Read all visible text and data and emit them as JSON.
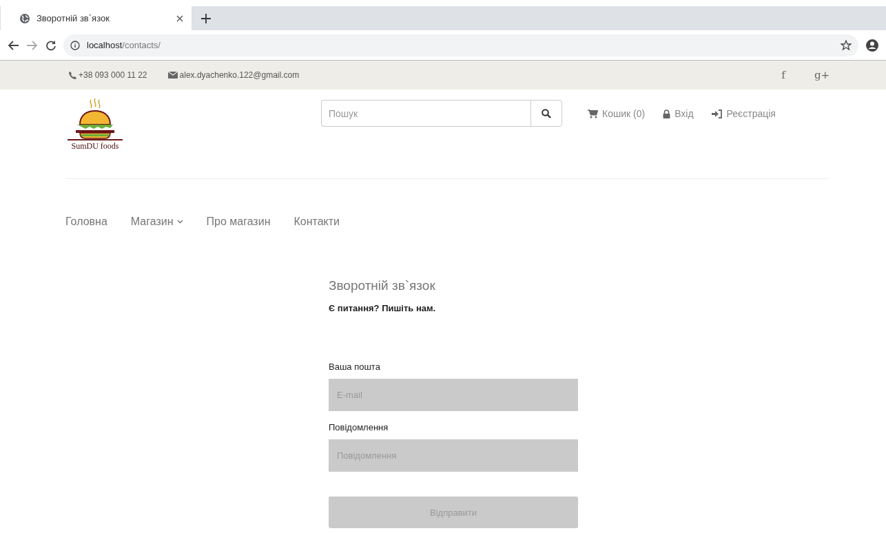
{
  "browser": {
    "tab_title": "Зворотній зв`язок",
    "url_host": "localhost",
    "url_path": "/contacts/"
  },
  "top_bar": {
    "phone": "+38 093 000 11 22",
    "email": "alex.dyachenko.122@gmail.com",
    "social": [
      "f",
      "g+"
    ]
  },
  "header": {
    "logo_text": "SumDU foods",
    "search": {
      "placeholder": "Пошук"
    },
    "links": [
      {
        "kind": "cart",
        "label": "Кошик (0)"
      },
      {
        "kind": "login",
        "label": "Вхід"
      },
      {
        "kind": "register",
        "label": "Реєстрація"
      }
    ]
  },
  "nav": [
    {
      "label": "Головна",
      "dropdown": false
    },
    {
      "label": "Магазин",
      "dropdown": true
    },
    {
      "label": "Про магазин",
      "dropdown": false
    },
    {
      "label": "Контакти",
      "dropdown": false
    }
  ],
  "form": {
    "title": "Зворотній зв`язок",
    "subtitle": "Є питання? Пишіть нам.",
    "fields": [
      {
        "label": "Ваша пошта",
        "placeholder": "E-mail"
      },
      {
        "label": "Повідомлення",
        "placeholder": "Повідомлення"
      }
    ],
    "submit": "Відправити"
  }
}
